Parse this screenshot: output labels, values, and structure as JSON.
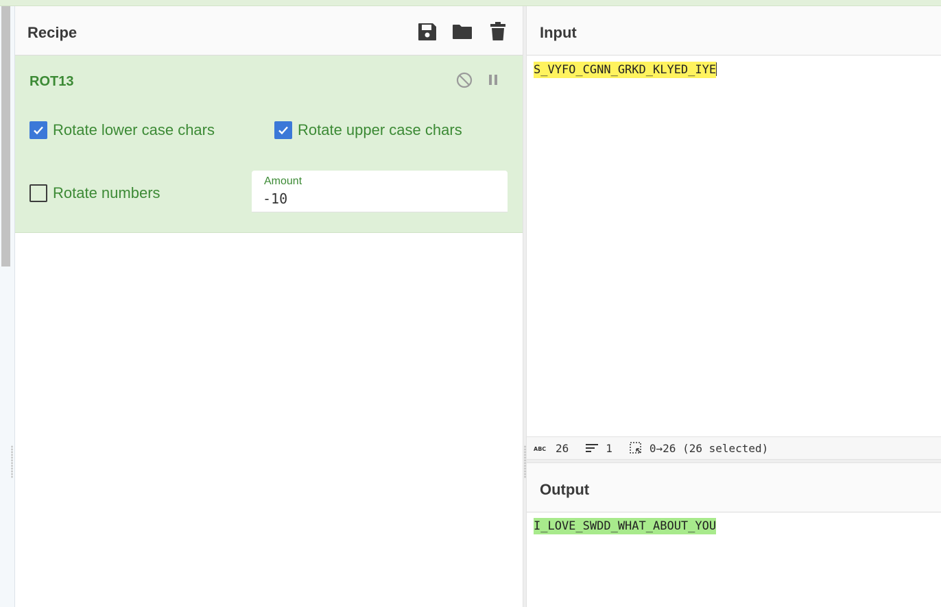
{
  "recipe": {
    "title": "Recipe",
    "icons": [
      "save-icon",
      "folder-icon",
      "trash-icon"
    ]
  },
  "operation": {
    "name": "ROT13",
    "options": {
      "rotate_lower": {
        "label": "Rotate lower case chars",
        "checked": true
      },
      "rotate_upper": {
        "label": "Rotate upper case chars",
        "checked": true
      },
      "rotate_numbers": {
        "label": "Rotate numbers",
        "checked": false
      }
    },
    "amount": {
      "label": "Amount",
      "value": "-10"
    }
  },
  "input": {
    "title": "Input",
    "text": "S_VYFO_CGNN_GRKD_KLYED_IYE"
  },
  "status": {
    "chars": "26",
    "lines": "1",
    "selection": "0→26 (26 selected)"
  },
  "output": {
    "title": "Output",
    "text": "I_LOVE_SWDD_WHAT_ABOUT_YOU"
  },
  "colors": {
    "accent_green": "#3c8a35",
    "operation_bg": "#dff0d8",
    "checkbox_blue": "#3b78d8",
    "input_highlight": "#fff35e",
    "output_highlight": "#a8ea8c"
  }
}
